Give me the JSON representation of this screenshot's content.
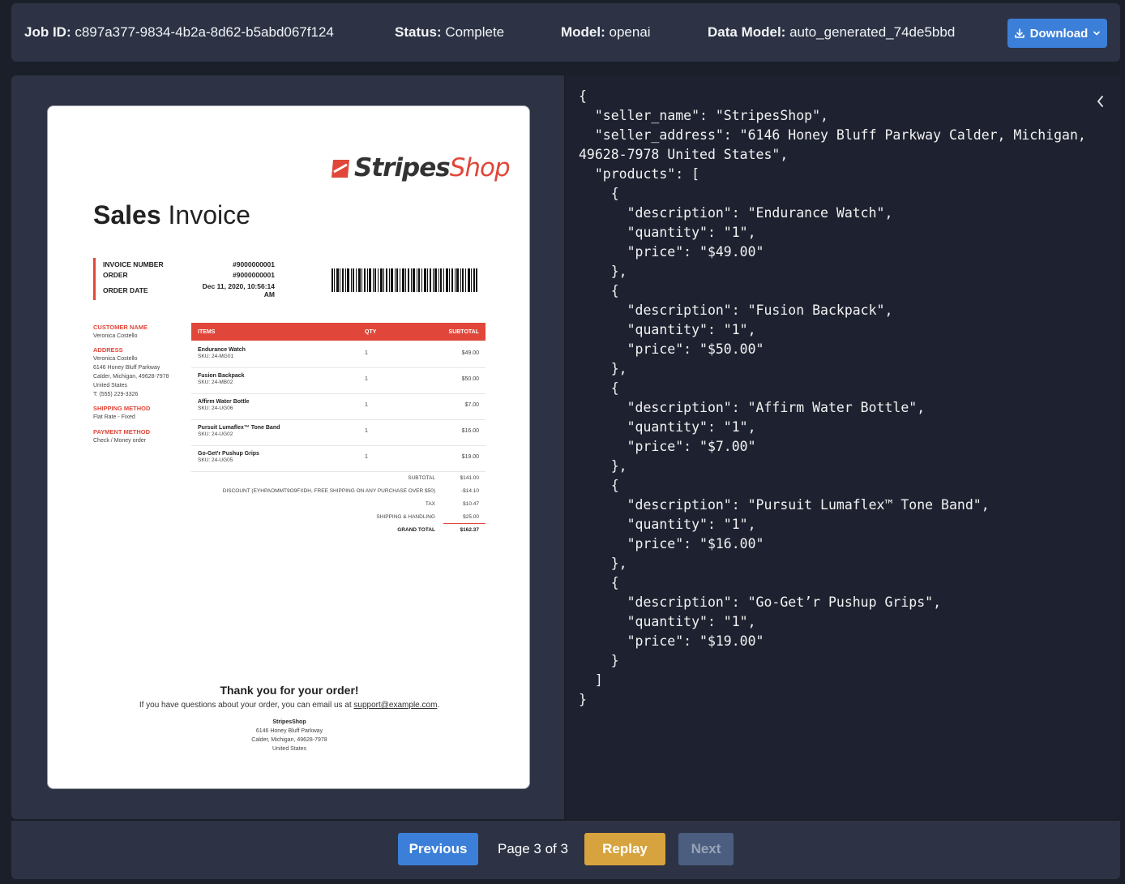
{
  "header": {
    "job_id_label": "Job ID:",
    "job_id": "c897a377-9834-4b2a-8d62-b5abd067f124",
    "status_label": "Status:",
    "status": "Complete",
    "model_label": "Model:",
    "model": "openai",
    "data_model_label": "Data Model:",
    "data_model": "auto_generated_74de5bbd",
    "download_label": "Download"
  },
  "invoice": {
    "brand_part1": "Stripes",
    "brand_part2": "Shop",
    "title_bold": "Sales",
    "title_rest": "Invoice",
    "invoice_number_label": "INVOICE NUMBER",
    "invoice_number": "#9000000001",
    "order_label": "ORDER",
    "order_number": "#9000000001",
    "order_date_label": "ORDER DATE",
    "order_date_line1": "Dec 11, 2020, 10:56:14",
    "order_date_line2": "AM",
    "customer_name_label": "CUSTOMER NAME",
    "customer_name": "Veronica Costello",
    "address_label": "ADDRESS",
    "address_lines": [
      "Veronica Costello",
      "6146 Honey Bluff Parkway",
      "Calder, Michigan, 49628-7978",
      "United States",
      "T: (555) 229-3326"
    ],
    "shipping_method_label": "SHIPPING METHOD",
    "shipping_method": "Flat Rate - Fixed",
    "payment_method_label": "PAYMENT METHOD",
    "payment_method": "Check / Money order",
    "col_items": "ITEMS",
    "col_qty": "QTY",
    "col_subtotal": "SUBTOTAL",
    "items": [
      {
        "name": "Endurance Watch",
        "sku": "SKU: 24-MG01",
        "qty": "1",
        "subtotal": "$49.00"
      },
      {
        "name": "Fusion Backpack",
        "sku": "SKU: 24-MB02",
        "qty": "1",
        "subtotal": "$50.00"
      },
      {
        "name": "Affirm Water Bottle",
        "sku": "SKU: 24-UG06",
        "qty": "1",
        "subtotal": "$7.00"
      },
      {
        "name": "Pursuit Lumaflex™ Tone Band",
        "sku": "SKU: 24-UG02",
        "qty": "1",
        "subtotal": "$16.00"
      },
      {
        "name": "Go-Get'r Pushup Grips",
        "sku": "SKU: 24-UG05",
        "qty": "1",
        "subtotal": "$19.00"
      }
    ],
    "totals": [
      {
        "label": "SUBTOTAL",
        "value": "$141.00"
      },
      {
        "label": "DISCOUNT (EYHPAOMMT9O9FXDH, FREE SHIPPING ON ANY PURCHASE OVER $50)",
        "value": "-$14.10"
      },
      {
        "label": "TAX",
        "value": "$10.47"
      },
      {
        "label": "SHIPPING & HANDLING",
        "value": "$25.00"
      }
    ],
    "grand_total_label": "GRAND TOTAL",
    "grand_total": "$162.37",
    "thanks": "Thank you for your order!",
    "questions_text": "If you have questions about your order, you can email us at",
    "support_email": "support@example.com",
    "footer_lines": [
      "StripesShop",
      "6146 Honey Bluff Parkway",
      "Calder, Michigan, 49628-7978",
      "United States"
    ]
  },
  "json_output": "{\n  \"seller_name\": \"StripesShop\",\n  \"seller_address\": \"6146 Honey Bluff Parkway Calder, Michigan,\n49628-7978 United States\",\n  \"products\": [\n    {\n      \"description\": \"Endurance Watch\",\n      \"quantity\": \"1\",\n      \"price\": \"$49.00\"\n    },\n    {\n      \"description\": \"Fusion Backpack\",\n      \"quantity\": \"1\",\n      \"price\": \"$50.00\"\n    },\n    {\n      \"description\": \"Affirm Water Bottle\",\n      \"quantity\": \"1\",\n      \"price\": \"$7.00\"\n    },\n    {\n      \"description\": \"Pursuit Lumaflex™ Tone Band\",\n      \"quantity\": \"1\",\n      \"price\": \"$16.00\"\n    },\n    {\n      \"description\": \"Go-Get’r Pushup Grips\",\n      \"quantity\": \"1\",\n      \"price\": \"$19.00\"\n    }\n  ]\n}",
  "pagination": {
    "previous_label": "Previous",
    "page_indicator": "Page 3 of 3",
    "replay_label": "Replay",
    "next_label": "Next"
  },
  "colors": {
    "accent_blue": "#3c7fd8",
    "replay_gold": "#d7a33e",
    "brand_red": "#e0473a",
    "panel": "#2d3344"
  },
  "icons": {
    "download": "download-icon",
    "dropdown": "chevron-down-icon",
    "collapse": "chevron-left-icon",
    "logo": "stripes-logo-icon",
    "barcode": "barcode-icon"
  }
}
